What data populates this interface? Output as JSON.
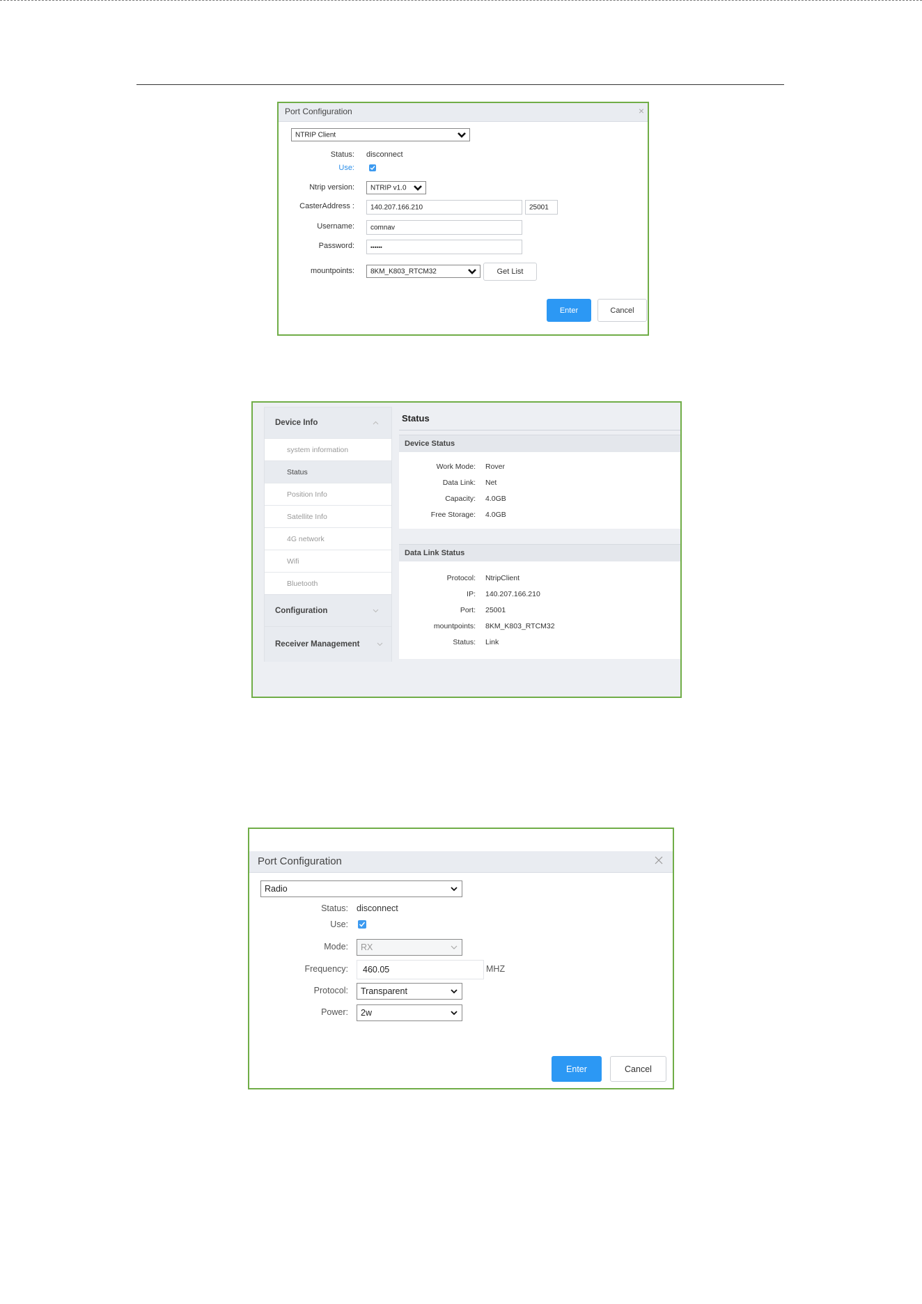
{
  "dialog_ntrip": {
    "title": "Port Configuration",
    "close_glyph": "×",
    "port_type": "NTRIP Client",
    "status_label": "Status:",
    "status_value": "disconnect",
    "use_label": "Use:",
    "use_checked": true,
    "ntrip_version_label": "Ntrip version:",
    "ntrip_version_value": "NTRIP v1.0",
    "caster_address_label": "CasterAddress :",
    "caster_address_value": "140.207.166.210",
    "caster_port_value": "25001",
    "username_label": "Username:",
    "username_value": "comnav",
    "password_label": "Password:",
    "password_value": "••••••",
    "mountpoints_label": "mountpoints:",
    "mountpoints_value": "8KM_K803_RTCM32",
    "get_list_label": "Get List",
    "enter_label": "Enter",
    "cancel_label": "Cancel"
  },
  "status_page": {
    "sidebar": {
      "device_info_label": "Device Info",
      "items": [
        {
          "label": "system information",
          "active": false
        },
        {
          "label": "Status",
          "active": true
        },
        {
          "label": "Position Info",
          "active": false
        },
        {
          "label": "Satellite Info",
          "active": false
        },
        {
          "label": "4G network",
          "active": false
        },
        {
          "label": "Wifi",
          "active": false
        },
        {
          "label": "Bluetooth",
          "active": false
        }
      ],
      "configuration_label": "Configuration",
      "receiver_management_label": "Receiver Management"
    },
    "title": "Status",
    "device_status": {
      "heading": "Device Status",
      "rows": [
        {
          "key": "Work Mode:",
          "value": "Rover"
        },
        {
          "key": "Data Link:",
          "value": "Net"
        },
        {
          "key": "Capacity:",
          "value": "4.0GB"
        },
        {
          "key": "Free Storage:",
          "value": "4.0GB"
        }
      ]
    },
    "data_link_status": {
      "heading": "Data Link Status",
      "rows": [
        {
          "key": "Protocol:",
          "value": "NtripClient"
        },
        {
          "key": "IP:",
          "value": "140.207.166.210"
        },
        {
          "key": "Port:",
          "value": "25001"
        },
        {
          "key": "mountpoints:",
          "value": "8KM_K803_RTCM32"
        },
        {
          "key": "Status:",
          "value": "Link"
        }
      ]
    }
  },
  "dialog_radio": {
    "title": "Port Configuration",
    "port_type": "Radio",
    "status_label": "Status:",
    "status_value": "disconnect",
    "use_label": "Use:",
    "use_checked": true,
    "mode_label": "Mode:",
    "mode_value": "RX",
    "frequency_label": "Frequency:",
    "frequency_value": "460.05",
    "frequency_unit": "MHZ",
    "protocol_label": "Protocol:",
    "protocol_value": "Transparent",
    "power_label": "Power:",
    "power_value": "2w",
    "enter_label": "Enter",
    "cancel_label": "Cancel"
  },
  "colors": {
    "frame_border": "#70ad47",
    "primary_button": "#2c98f4",
    "link_blue": "#2c8ee8",
    "header_gray": "#e9ecf1"
  },
  "icons": [
    "chevron-down-icon",
    "close-icon",
    "check-icon",
    "chevron-up-icon"
  ]
}
